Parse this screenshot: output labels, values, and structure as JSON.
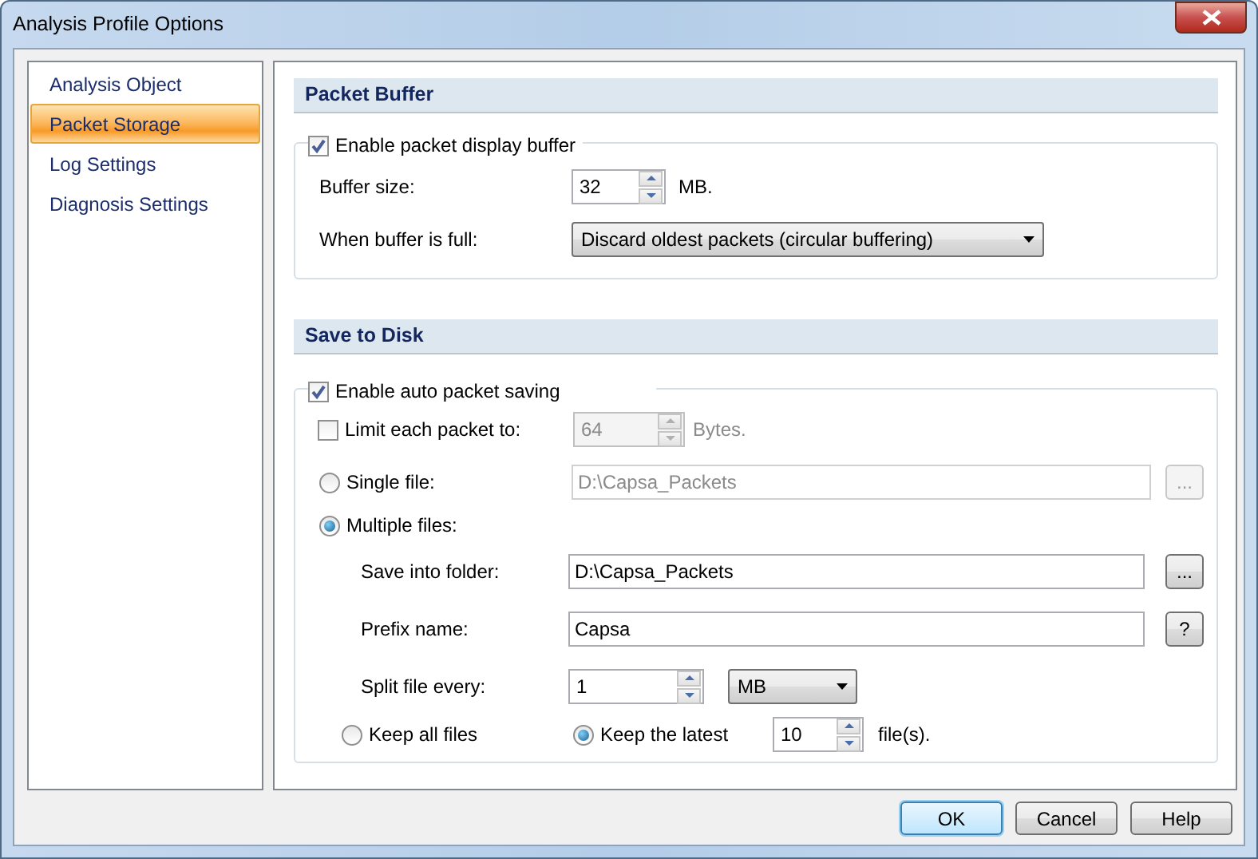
{
  "window": {
    "title": "Analysis Profile Options"
  },
  "sidebar": {
    "items": [
      {
        "label": "Analysis Object",
        "selected": false
      },
      {
        "label": "Packet Storage",
        "selected": true
      },
      {
        "label": "Log Settings",
        "selected": false
      },
      {
        "label": "Diagnosis Settings",
        "selected": false
      }
    ]
  },
  "packet_buffer": {
    "title": "Packet Buffer",
    "enable": {
      "label": "Enable packet display buffer",
      "checked": true
    },
    "buffer_size": {
      "label": "Buffer size:",
      "value": "32",
      "unit": "MB."
    },
    "when_full": {
      "label": "When buffer is full:",
      "value": "Discard oldest packets (circular buffering)"
    }
  },
  "save_to_disk": {
    "title": "Save to Disk",
    "enable": {
      "label": "Enable auto packet saving",
      "checked": true
    },
    "limit": {
      "label": "Limit each packet to:",
      "checked": false,
      "value": "64",
      "unit": "Bytes."
    },
    "modes": [
      {
        "label": "Single file:",
        "selected": false
      },
      {
        "label": "Multiple files:",
        "selected": true
      }
    ],
    "single_file": {
      "value": "D:\\Capsa_Packets",
      "button": "..."
    },
    "folder": {
      "label": "Save into folder:",
      "value": "D:\\Capsa_Packets",
      "button": "..."
    },
    "prefix": {
      "label": "Prefix name:",
      "value": "Capsa",
      "button": "?"
    },
    "split": {
      "label": "Split file every:",
      "value": "1",
      "unit": "MB"
    },
    "keep": [
      {
        "label": "Keep all files",
        "selected": false
      },
      {
        "label": "Keep the latest",
        "selected": true
      }
    ],
    "keep_count": {
      "value": "10",
      "unit": "file(s)."
    }
  },
  "buttons": [
    {
      "label": "OK",
      "default": true
    },
    {
      "label": "Cancel",
      "default": false
    },
    {
      "label": "Help",
      "default": false
    }
  ]
}
